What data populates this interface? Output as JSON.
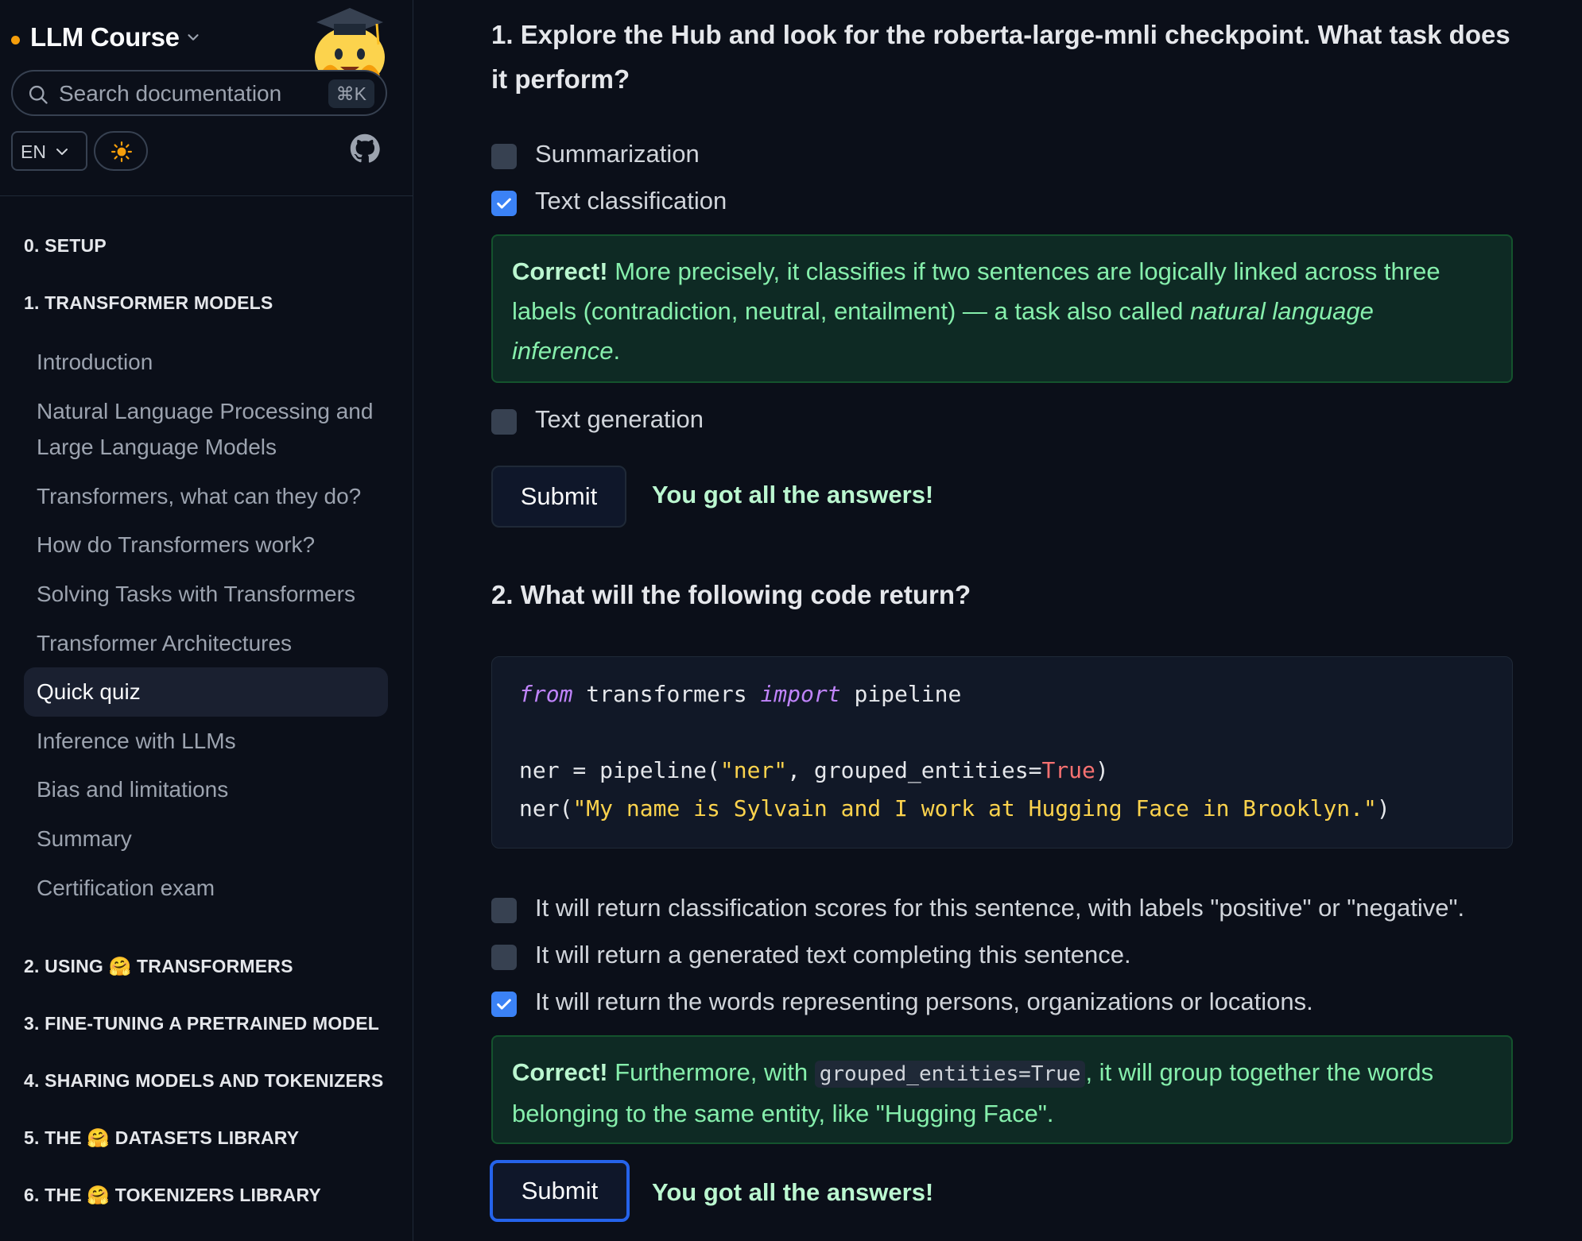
{
  "sidebar": {
    "brand": "LLM Course",
    "search_placeholder": "Search documentation",
    "search_shortcut": "⌘K",
    "language": "EN",
    "colors": {
      "brand_dot": "#f59e0b",
      "active_bg": "#1a2030"
    },
    "sections": [
      {
        "title": "0. SETUP"
      },
      {
        "title": "1. TRANSFORMER MODELS",
        "items": [
          "Introduction",
          "Natural Language Processing and",
          "Large Language Models",
          "Transformers, what can they do?",
          "How do Transformers work?",
          "Solving Tasks with Transformers",
          "Transformer Architectures",
          "Quick quiz",
          "Inference with LLMs",
          "Bias and limitations",
          "Summary",
          "Certification exam"
        ],
        "active_index": 7
      },
      {
        "title": "2. USING 🤗 TRANSFORMERS"
      },
      {
        "title": "3. FINE-TUNING A PRETRAINED MODEL"
      },
      {
        "title": "4. SHARING MODELS AND TOKENIZERS"
      },
      {
        "title": "5. THE 🤗 DATASETS LIBRARY"
      },
      {
        "title": "6. THE 🤗 TOKENIZERS LIBRARY"
      }
    ]
  },
  "quiz": {
    "q1": {
      "line1": "1. Explore the Hub and look for the roberta-large-mnli checkpoint. What task does",
      "line2": "it perform?",
      "options": [
        {
          "label": "Summarization",
          "checked": false
        },
        {
          "label": "Text classification",
          "checked": true
        },
        {
          "label": "Text generation",
          "checked": false
        }
      ],
      "feedback": {
        "prefix": "Correct!",
        "text1": " More precisely, it classifies if two sentences are logically linked across three",
        "text2": "labels (contradiction, neutral, entailment) — a task also called ",
        "italic1": "natural language",
        "italic2": "inference",
        "end": "."
      },
      "submit": "Submit",
      "result": "You got all the answers!"
    },
    "q2": {
      "title": "2. What will the following code return?",
      "code": {
        "l1_kw1": "from",
        "l1_mod": " transformers ",
        "l1_kw2": "import",
        "l1_name": " pipeline",
        "l2_a": "ner = pipeline(",
        "l2_str": "\"ner\"",
        "l2_b": ", grouped_entities=",
        "l2_bool": "True",
        "l2_c": ")",
        "l3_a": "ner(",
        "l3_str": "\"My name is Sylvain and I work at Hugging Face in Brooklyn.\"",
        "l3_c": ")"
      },
      "options": [
        {
          "label": "It will return classification scores for this sentence, with labels \"positive\" or \"negative\".",
          "checked": false
        },
        {
          "label": "It will return a generated text completing this sentence.",
          "checked": false
        },
        {
          "label": "It will return the words representing persons, organizations or locations.",
          "checked": true
        }
      ],
      "feedback": {
        "prefix": "Correct!",
        "text1": " Furthermore, with ",
        "code": "grouped_entities=True",
        "text2": ", it will group together the words",
        "text3": "belonging to the same entity, like \"Hugging Face\"."
      },
      "submit": "Submit",
      "result": "You got all the answers!"
    }
  }
}
